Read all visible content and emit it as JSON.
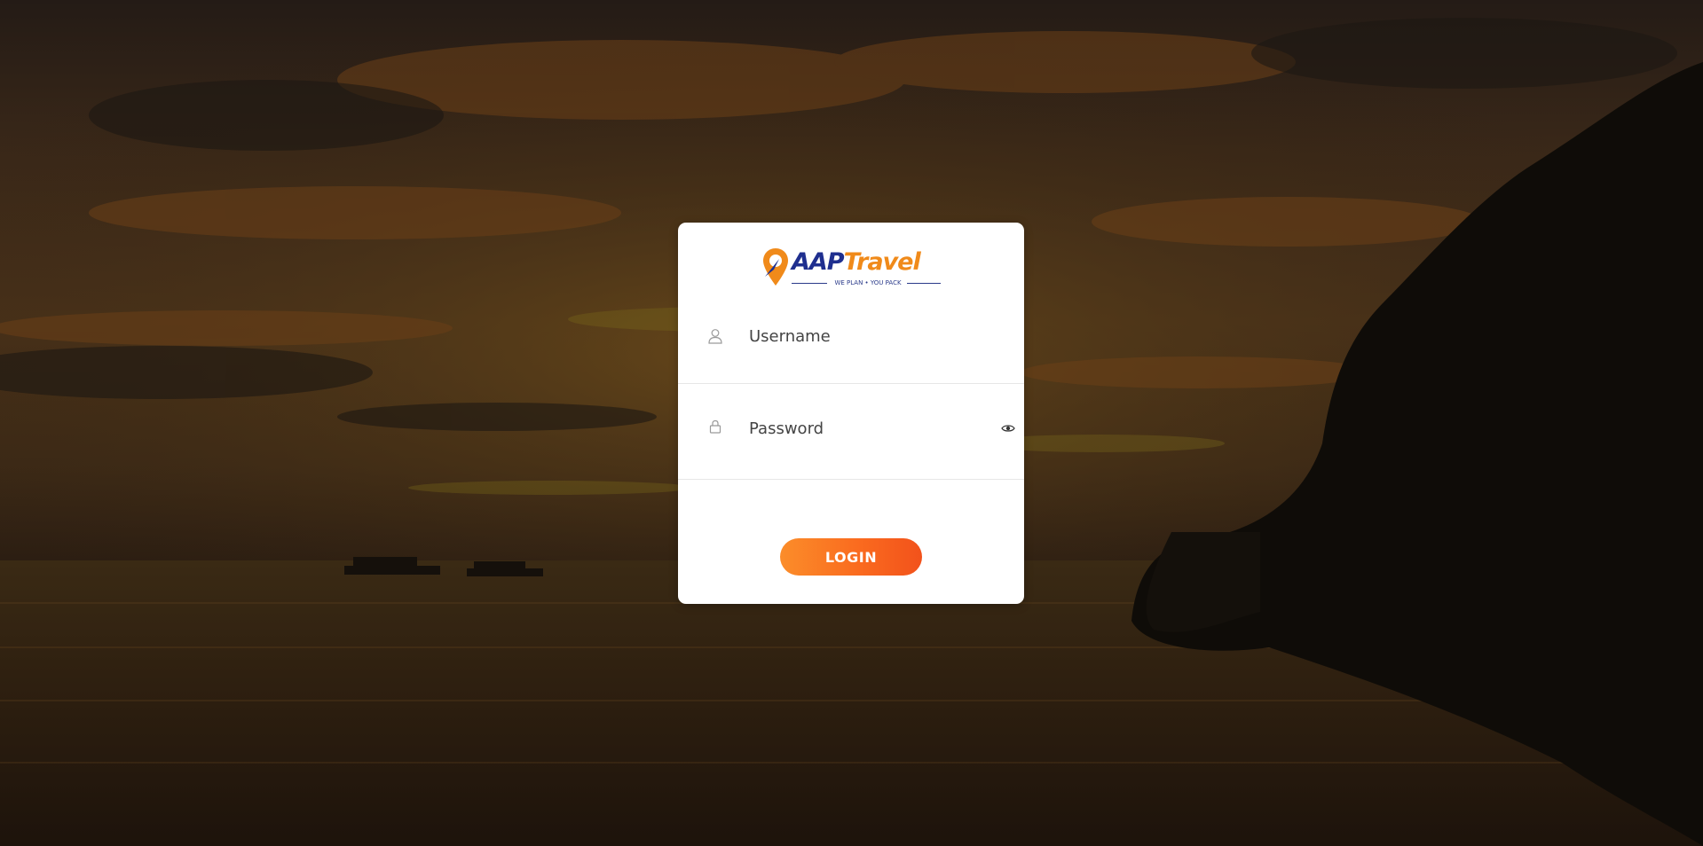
{
  "brand": {
    "name_part1": "AAP",
    "name_part2": "Travel",
    "tagline": "WE PLAN • YOU PACK",
    "colors": {
      "primary": "#1f2f8f",
      "accent": "#f08a1a"
    }
  },
  "form": {
    "username": {
      "placeholder": "Username",
      "value": "",
      "icon": "user-icon"
    },
    "password": {
      "placeholder": "Password",
      "value": "",
      "icon": "lock-icon",
      "toggle_icon": "eye-icon"
    },
    "login_label": "LOGIN"
  },
  "colors": {
    "button_gradient_start": "#fb8d2a",
    "button_gradient_end": "#f2521b",
    "card_bg": "#ffffff"
  }
}
